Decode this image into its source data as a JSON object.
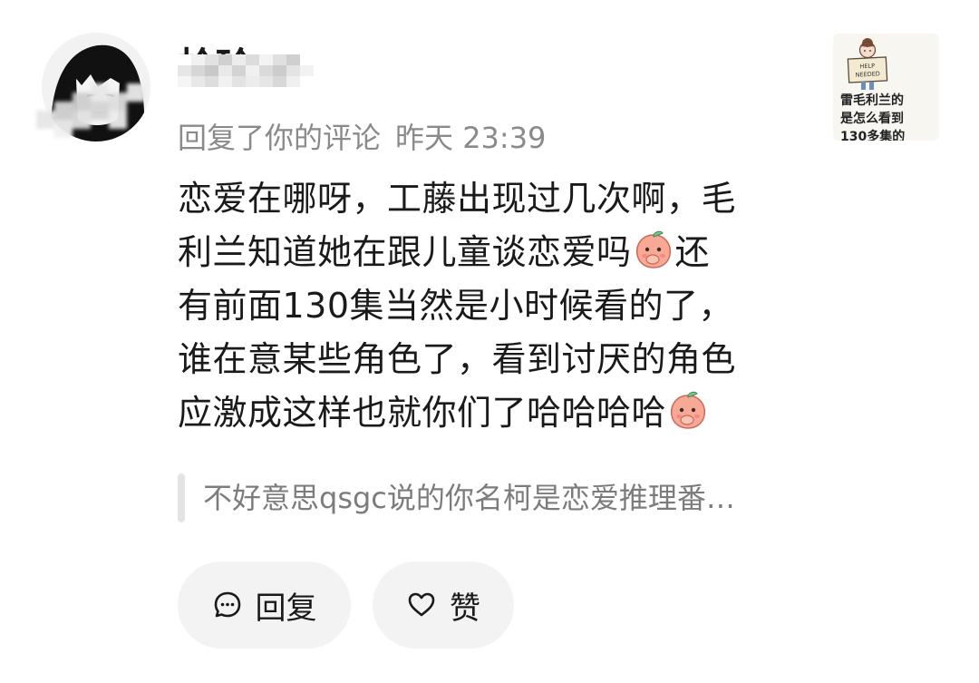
{
  "comment": {
    "username": "柃玲",
    "action": "回复了你的评论",
    "time": "昨天 23:39",
    "body_lines": [
      "恋爱在哪呀，工藤出现过几次啊，毛",
      "利兰知道她在跟儿童谈恋爱吗",
      "还",
      "有前面130集当然是小时候看的了，",
      "谁在意某些角色了，看到讨厌的角色",
      "应激成这样也就你们了哈哈哈哈"
    ],
    "quoted": "不好意思qsgc说的你名柯是恋爱推理番…"
  },
  "actions": {
    "reply_label": "回复",
    "like_label": "赞"
  },
  "thumbnail": {
    "sign_text_1": "HELP",
    "sign_text_2": "NEEDED",
    "caption_lines": [
      "雷毛利兰的",
      "是怎么看到",
      "130多集的"
    ]
  },
  "icons": {
    "reply": "comment-bubble-icon",
    "like": "heart-outline-icon",
    "emoji": "peach-cover-mouth-emoji"
  }
}
